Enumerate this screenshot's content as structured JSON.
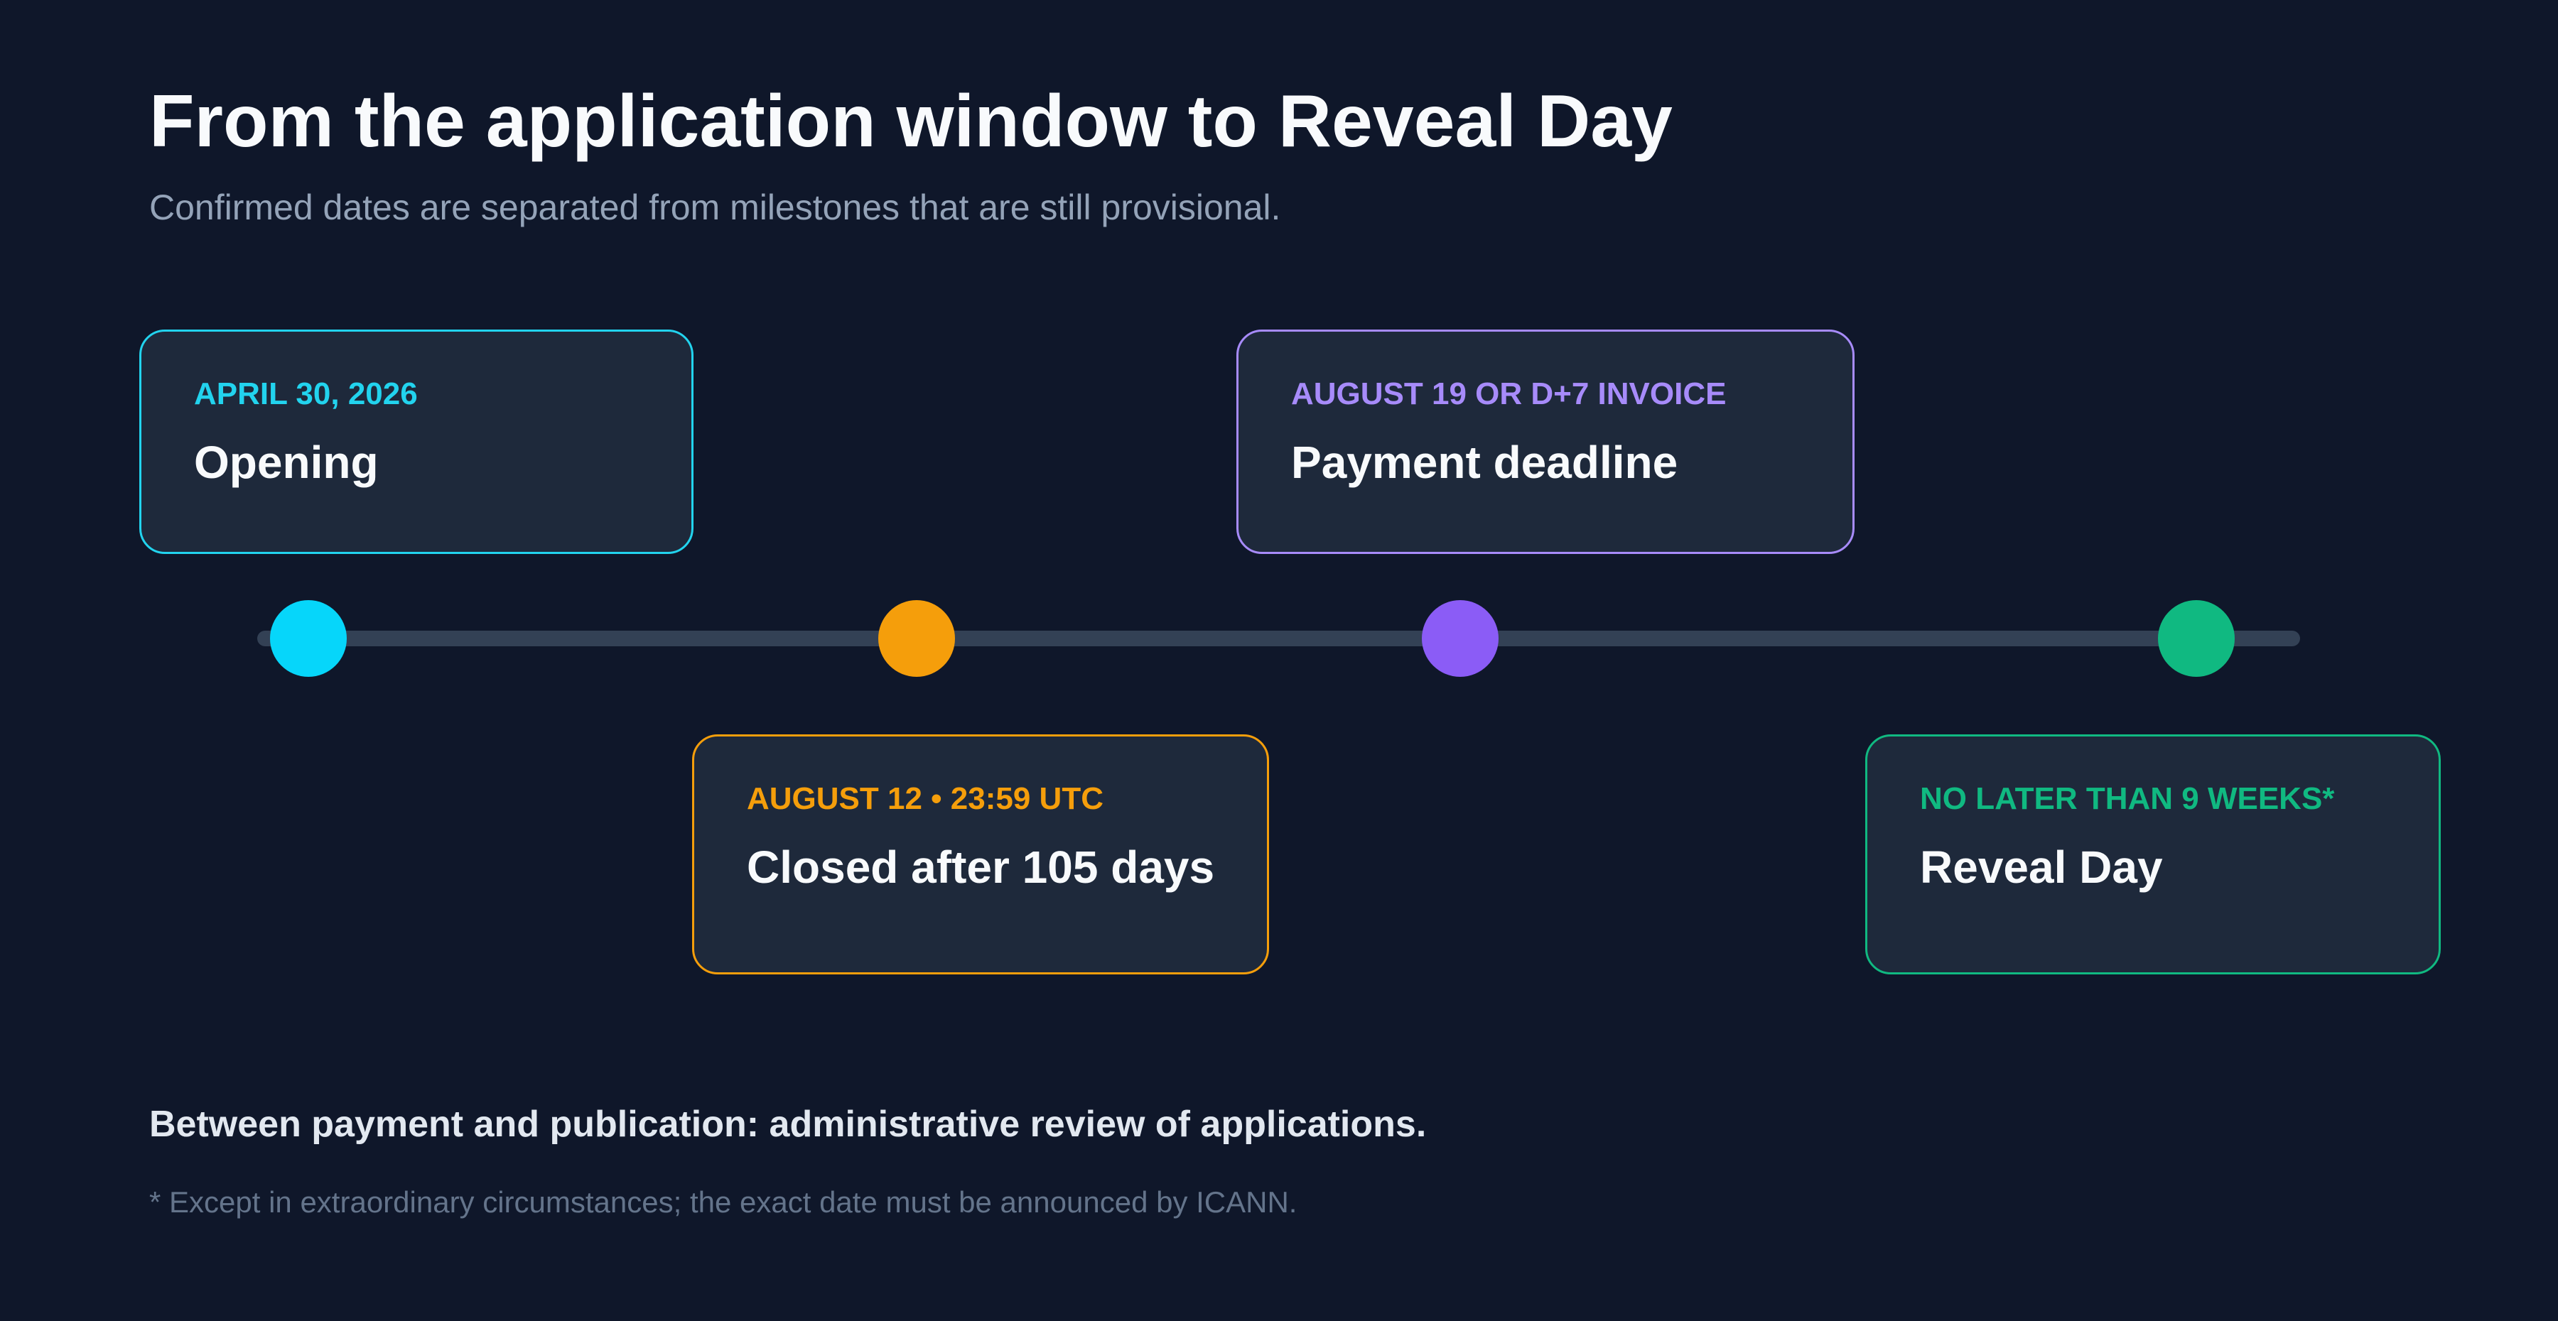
{
  "header": {
    "title": "From the application window to Reveal Day",
    "subtitle": "Confirmed dates are separated from milestones that are still provisional."
  },
  "milestones": [
    {
      "date": "APRIL 30, 2026",
      "label": "Opening",
      "color": "#22d3ee",
      "dot_color": "#06d6fa",
      "side": "top"
    },
    {
      "date": "AUGUST 12 • 23:59 UTC",
      "label": "Closed after 105 days",
      "color": "#f59e0b",
      "dot_color": "#f59e0b",
      "side": "bottom"
    },
    {
      "date": "AUGUST 19 OR D+7 INVOICE",
      "label": "Payment deadline",
      "color": "#a78bfa",
      "dot_color": "#8b5cf6",
      "side": "top"
    },
    {
      "date": "NO LATER THAN 9 WEEKS*",
      "label": "Reveal Day",
      "color": "#10b981",
      "dot_color": "#10b981",
      "side": "bottom"
    }
  ],
  "footer": {
    "note": "Between payment and publication: administrative review of applications.",
    "footnote": "* Except in extraordinary circumstances; the exact date must be announced by ICANN."
  },
  "colors": {
    "background": "#0f172a",
    "card_background": "#1e293b",
    "track": "#334155"
  }
}
